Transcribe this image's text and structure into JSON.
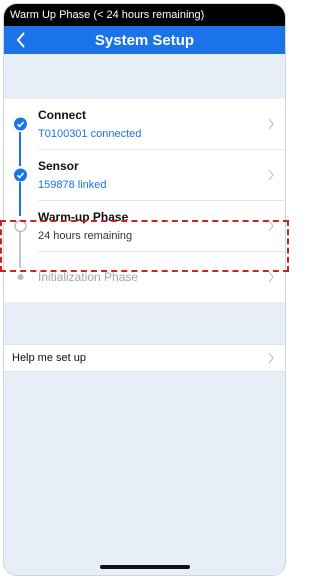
{
  "status_bar": {
    "text": "Warm Up Phase (< 24 hours remaining)"
  },
  "nav": {
    "title": "System Setup"
  },
  "steps": [
    {
      "title": "Connect",
      "subtitle": "T0100301 connected",
      "state": "done"
    },
    {
      "title": "Sensor",
      "subtitle": "159878 linked",
      "state": "done"
    },
    {
      "title": "Warm-up Phase",
      "subtitle": "24 hours remaining",
      "state": "current"
    },
    {
      "title": "Initialization Phase",
      "subtitle": "",
      "state": "pending"
    }
  ],
  "help": {
    "label": "Help me set up"
  },
  "colors": {
    "accent": "#1a73e8",
    "highlight": "#cc2222",
    "background": "#e8eef7"
  }
}
